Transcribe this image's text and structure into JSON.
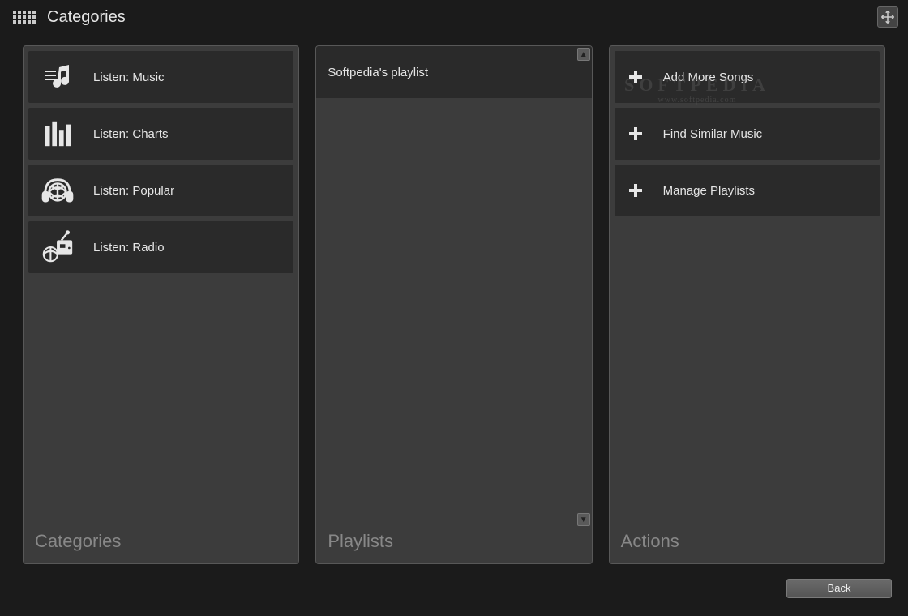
{
  "header": {
    "title": "Categories"
  },
  "panels": {
    "categories": {
      "footer": "Categories",
      "items": [
        {
          "label": "Listen: Music"
        },
        {
          "label": "Listen: Charts"
        },
        {
          "label": "Listen: Popular"
        },
        {
          "label": "Listen: Radio"
        }
      ]
    },
    "playlists": {
      "footer": "Playlists",
      "items": [
        {
          "label": "Softpedia's playlist"
        }
      ]
    },
    "actions": {
      "footer": "Actions",
      "items": [
        {
          "label": "Add More Songs"
        },
        {
          "label": "Find Similar Music"
        },
        {
          "label": "Manage Playlists"
        }
      ]
    }
  },
  "buttons": {
    "back": "Back"
  },
  "watermark": {
    "line1": "SOFTPEDIA",
    "line2": "www.softpedia.com"
  }
}
